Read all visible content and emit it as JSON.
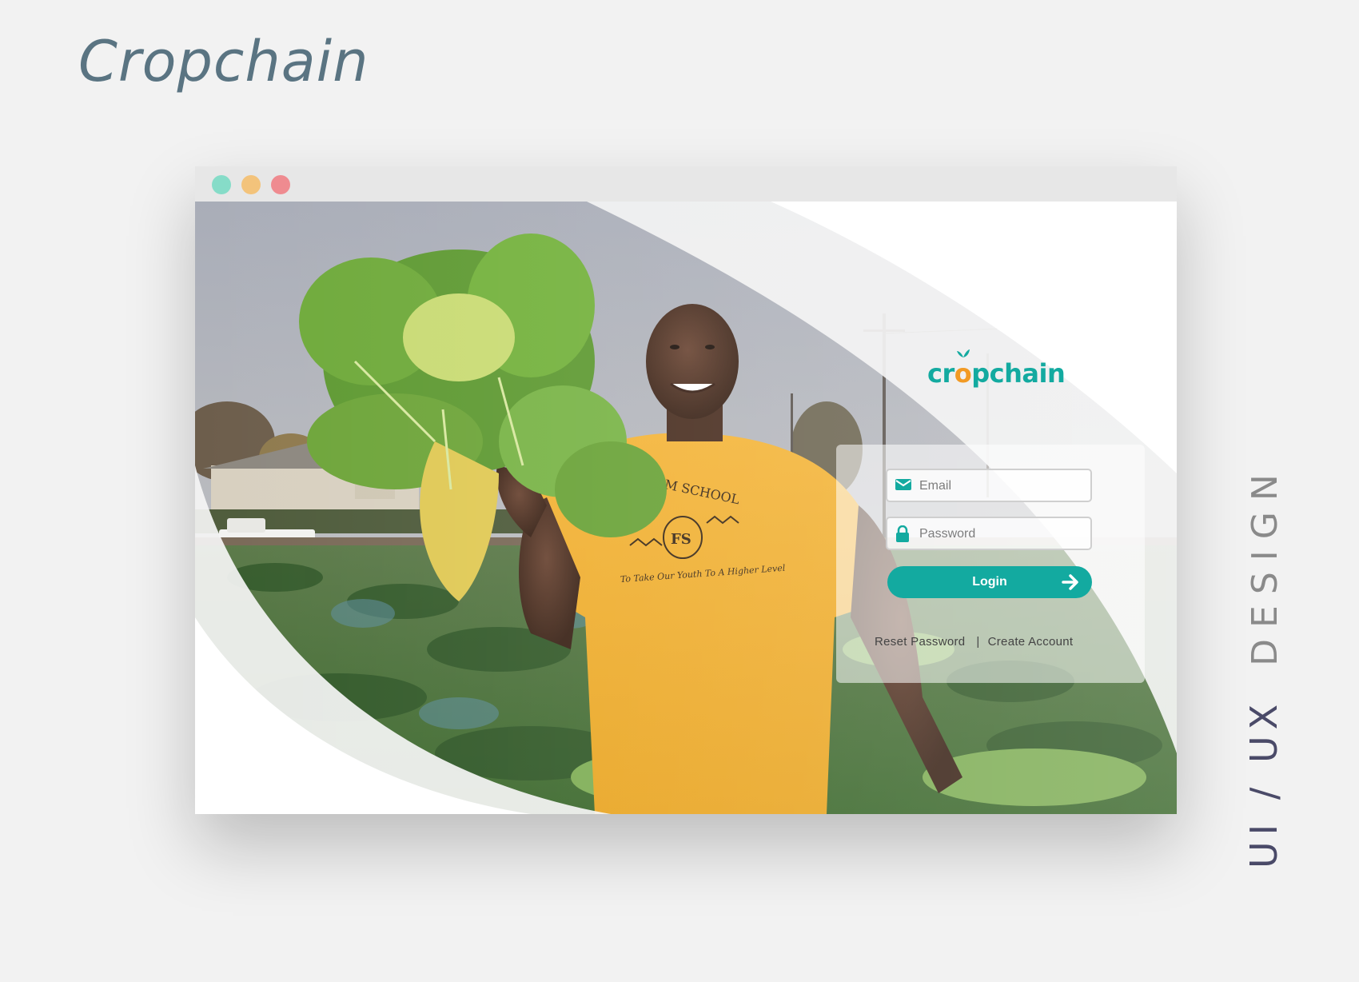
{
  "page": {
    "title": "Cropchain",
    "caption_primary": "UI / UX",
    "caption_secondary": "DESIGN"
  },
  "window": {
    "controls": [
      "green-dot",
      "yellow-dot",
      "red-dot"
    ]
  },
  "brand": {
    "logo_prefix": "cr",
    "logo_o": "o",
    "logo_suffix": "pchain",
    "color_primary": "#13aaa0",
    "color_accent": "#f29a24"
  },
  "login": {
    "email_placeholder": "Email",
    "password_placeholder": "Password",
    "login_label": "Login",
    "reset_password": "Reset Password",
    "separator": "|",
    "create_account": "Create Account",
    "email_icon": "envelope-icon",
    "password_icon": "lock-icon",
    "login_icon": "arrow-right-icon"
  },
  "hero": {
    "shirt_text_top": "OM SCHOOL",
    "shirt_monogram": "FS",
    "shirt_text_bottom": "To Take Our Youth To A Higher Level"
  }
}
